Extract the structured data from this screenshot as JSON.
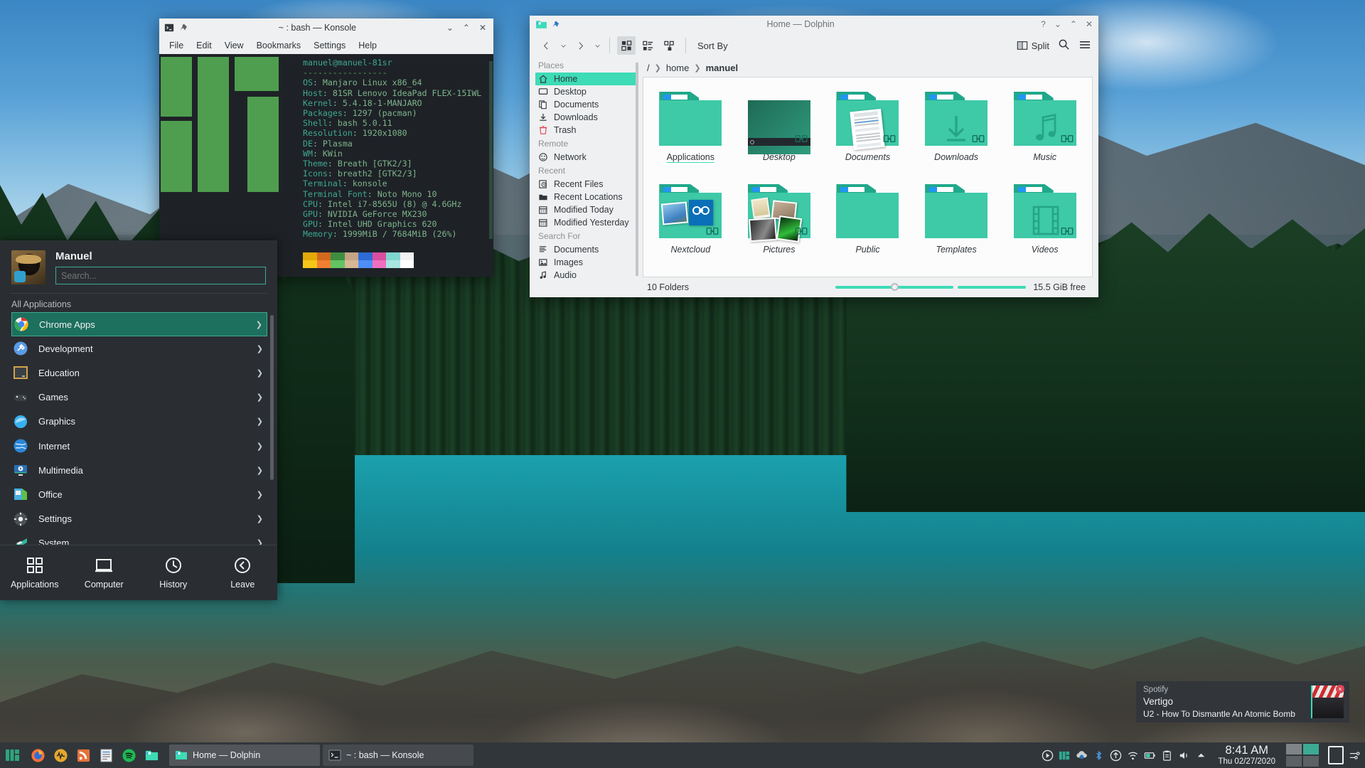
{
  "desktop": {
    "wallpaper_name": "moraine-lake"
  },
  "konsole": {
    "title": "~ : bash — Konsole",
    "menu": [
      "File",
      "Edit",
      "View",
      "Bookmarks",
      "Settings",
      "Help"
    ],
    "window_buttons": [
      "minimize",
      "maximize",
      "close"
    ],
    "neofetch": {
      "user_host": "manuel@manuel-81sr",
      "rule": "-----------------",
      "rows": [
        {
          "key": "OS",
          "value": "Manjaro Linux x86_64"
        },
        {
          "key": "Host",
          "value": "81SR Lenovo IdeaPad FLEX-15IWL"
        },
        {
          "key": "Kernel",
          "value": "5.4.18-1-MANJARO"
        },
        {
          "key": "Packages",
          "value": "1297 (pacman)"
        },
        {
          "key": "Shell",
          "value": "bash 5.0.11"
        },
        {
          "key": "Resolution",
          "value": "1920x1080"
        },
        {
          "key": "DE",
          "value": "Plasma"
        },
        {
          "key": "WM",
          "value": "KWin"
        },
        {
          "key": "Theme",
          "value": "Breath [GTK2/3]"
        },
        {
          "key": "Icons",
          "value": "breath2 [GTK2/3]"
        },
        {
          "key": "Terminal",
          "value": "konsole"
        },
        {
          "key": "Terminal Font",
          "value": "Noto Mono 10"
        },
        {
          "key": "CPU",
          "value": "Intel i7-8565U (8) @ 4.6GHz"
        },
        {
          "key": "GPU",
          "value": "NVIDIA GeForce MX230"
        },
        {
          "key": "GPU",
          "value": "Intel UHD Graphics 620"
        },
        {
          "key": "Memory",
          "value": "1999MiB / 7684MiB (26%)"
        }
      ],
      "palette_row1": [
        "#e3a80a",
        "#d2691e",
        "#3e8e41",
        "#c4a484",
        "#2e6bd6",
        "#d94fa0",
        "#7fd6cf",
        "#f2f2f2"
      ],
      "palette_row2": [
        "#f5c518",
        "#f08030",
        "#62c462",
        "#d8b894",
        "#4f8ef7",
        "#f06fc0",
        "#a8e6e0",
        "#ffffff"
      ]
    }
  },
  "dolphin": {
    "title": "Home — Dolphin",
    "window_buttons": [
      "help",
      "minimize",
      "maximize",
      "close"
    ],
    "toolbar": {
      "back": "back",
      "forward": "forward",
      "view_icons": "icons-view",
      "view_compact": "compact-view",
      "view_details": "details-view",
      "sort_by": "Sort By",
      "split": "Split",
      "search": "search",
      "menu": "menu"
    },
    "breadcrumb": {
      "root": "/",
      "parts": [
        "home",
        "manuel"
      ]
    },
    "places": {
      "sections": [
        {
          "title": "Places",
          "items": [
            {
              "label": "Home",
              "icon": "home-icon",
              "selected": true
            },
            {
              "label": "Desktop",
              "icon": "desktop-icon",
              "selected": false
            },
            {
              "label": "Documents",
              "icon": "documents-icon",
              "selected": false
            },
            {
              "label": "Downloads",
              "icon": "downloads-icon",
              "selected": false
            },
            {
              "label": "Trash",
              "icon": "trash-icon",
              "selected": false
            }
          ]
        },
        {
          "title": "Remote",
          "items": [
            {
              "label": "Network",
              "icon": "network-icon",
              "selected": false
            }
          ]
        },
        {
          "title": "Recent",
          "items": [
            {
              "label": "Recent Files",
              "icon": "recent-files-icon",
              "selected": false
            },
            {
              "label": "Recent Locations",
              "icon": "recent-locations-icon",
              "selected": false
            },
            {
              "label": "Modified Today",
              "icon": "calendar-icon",
              "selected": false
            },
            {
              "label": "Modified Yesterday",
              "icon": "calendar-icon",
              "selected": false
            }
          ]
        },
        {
          "title": "Search For",
          "items": [
            {
              "label": "Documents",
              "icon": "search-documents-icon",
              "selected": false
            },
            {
              "label": "Images",
              "icon": "search-images-icon",
              "selected": false
            },
            {
              "label": "Audio",
              "icon": "search-audio-icon",
              "selected": false
            }
          ]
        }
      ]
    },
    "folders": [
      {
        "name": "Applications",
        "thumb": "plain",
        "underline": true
      },
      {
        "name": "Desktop",
        "thumb": "desktop-preview",
        "underline": false
      },
      {
        "name": "Documents",
        "thumb": "document-preview",
        "underline": false
      },
      {
        "name": "Downloads",
        "thumb": "download-arrow",
        "underline": false
      },
      {
        "name": "Music",
        "thumb": "music-note",
        "underline": false
      },
      {
        "name": "Nextcloud",
        "thumb": "nextcloud-preview",
        "underline": false
      },
      {
        "name": "Pictures",
        "thumb": "pictures-preview",
        "underline": false
      },
      {
        "name": "Public",
        "thumb": "plain",
        "underline": false
      },
      {
        "name": "Templates",
        "thumb": "plain",
        "underline": false
      },
      {
        "name": "Videos",
        "thumb": "film-strip",
        "underline": false
      }
    ],
    "status": {
      "count": "10 Folders",
      "free_space": "15.5 GiB free"
    }
  },
  "kickoff": {
    "username": "Manuel",
    "search_placeholder": "Search...",
    "section_label": "All Applications",
    "categories": [
      {
        "label": "Chrome Apps",
        "icon": "chrome-icon",
        "selected": true
      },
      {
        "label": "Development",
        "icon": "development-icon",
        "selected": false
      },
      {
        "label": "Education",
        "icon": "education-icon",
        "selected": false
      },
      {
        "label": "Games",
        "icon": "games-icon",
        "selected": false
      },
      {
        "label": "Graphics",
        "icon": "graphics-icon",
        "selected": false
      },
      {
        "label": "Internet",
        "icon": "internet-icon",
        "selected": false
      },
      {
        "label": "Multimedia",
        "icon": "multimedia-icon",
        "selected": false
      },
      {
        "label": "Office",
        "icon": "office-icon",
        "selected": false
      },
      {
        "label": "Settings",
        "icon": "settings-icon",
        "selected": false
      },
      {
        "label": "System",
        "icon": "system-icon",
        "selected": false
      }
    ],
    "tabs": [
      {
        "label": "Applications",
        "icon": "grid-icon",
        "active": true
      },
      {
        "label": "Computer",
        "icon": "computer-icon",
        "active": false
      },
      {
        "label": "History",
        "icon": "clock-icon",
        "active": false
      },
      {
        "label": "Leave",
        "icon": "leave-icon",
        "active": false
      }
    ]
  },
  "panel": {
    "launcher": "manjaro-launcher",
    "quick_launch": [
      "firefox-icon",
      "audacity-icon",
      "feedreader-icon",
      "texteditor-icon",
      "spotify-icon",
      "dolphin-icon"
    ],
    "tasks": [
      {
        "label": "Home — Dolphin",
        "icon": "dolphin-icon",
        "active": true
      },
      {
        "label": "~ : bash — Konsole",
        "icon": "konsole-icon",
        "active": false
      }
    ],
    "tray": [
      "media-play-icon",
      "manjaro-icon",
      "nextcloud-icon",
      "bluetooth-icon",
      "updates-icon",
      "wifi-icon",
      "battery-icon",
      "clipboard-icon",
      "volume-icon",
      "show-hidden-icon"
    ],
    "clock": {
      "time": "8:41 AM",
      "date": "Thu 02/27/2020"
    },
    "pager": [
      "desktop-1",
      "desktop-2"
    ],
    "show_desktop": "show-desktop"
  },
  "notification": {
    "app": "Spotify",
    "track": "Vertigo",
    "subtitle": "U2 - How To Dismantle An Atomic Bomb",
    "close": "×"
  },
  "colors": {
    "accent": "#3ddbb6",
    "folder": "#3ec9a7",
    "panel_bg": "#31363b",
    "menu_bg": "#2a2e32",
    "terminal_bg": "#1e2227",
    "terminal_green": "#4f9e4f",
    "notif_close": "#da4453"
  }
}
